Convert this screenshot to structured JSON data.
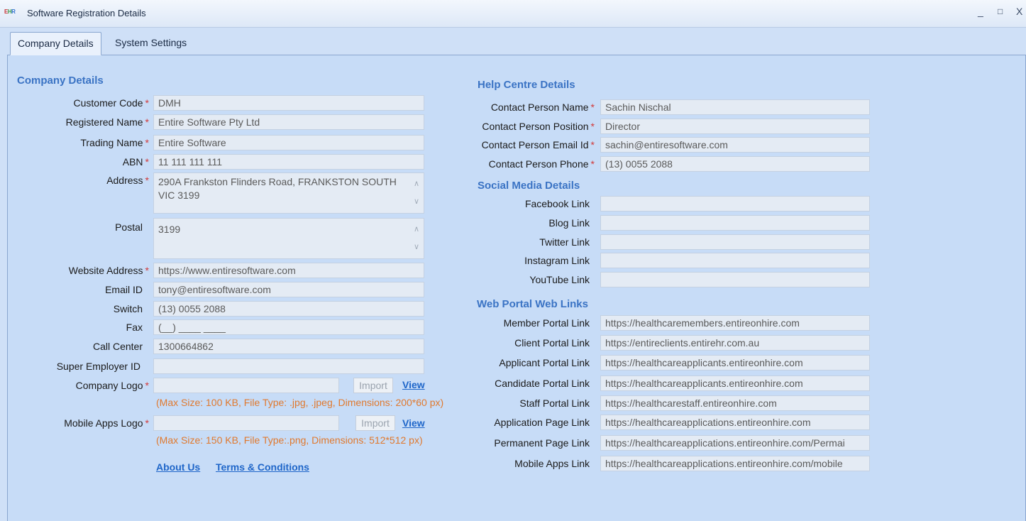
{
  "window": {
    "title": "Software Registration Details",
    "icon_letters": [
      "E",
      "H",
      "R"
    ],
    "minimize": "_",
    "maximize": "□",
    "close": "X"
  },
  "tabs": [
    "Company Details",
    "System Settings"
  ],
  "company": {
    "section_title": "Company Details",
    "customer_code": {
      "label": "Customer Code",
      "value": "DMH"
    },
    "registered_name": {
      "label": "Registered Name",
      "value": "Entire Software Pty Ltd"
    },
    "trading_name": {
      "label": "Trading Name",
      "value": "Entire Software"
    },
    "abn": {
      "label": "ABN",
      "value": "11 111 111 111"
    },
    "address": {
      "label": "Address",
      "value": "290A Frankston Flinders Road, FRANKSTON SOUTH VIC 3199"
    },
    "postal": {
      "label": "Postal",
      "value": "3199"
    },
    "website": {
      "label": "Website Address",
      "value": "https://www.entiresoftware.com"
    },
    "email": {
      "label": "Email ID",
      "value": "tony@entiresoftware.com"
    },
    "switch": {
      "label": "Switch",
      "value": "(13) 0055 2088"
    },
    "fax": {
      "label": "Fax",
      "value": "(__) ____ ____"
    },
    "call_center": {
      "label": "Call Center",
      "value": "1300664862"
    },
    "super_employer": {
      "label": "Super Employer ID",
      "value": ""
    },
    "company_logo": {
      "label": "Company Logo",
      "value": "",
      "import": "Import",
      "view": "View",
      "hint": "(Max Size: 100 KB, File Type: .jpg, .jpeg, Dimensions: 200*60 px)"
    },
    "mobile_logo": {
      "label": "Mobile Apps Logo",
      "value": "",
      "import": "Import",
      "view": "View",
      "hint": "(Max Size: 150 KB, File Type:.png, Dimensions: 512*512 px)"
    },
    "about_us": "About Us",
    "terms": "Terms & Conditions",
    "required_mark": "*"
  },
  "help": {
    "section_title": "Help Centre Details",
    "contact_name": {
      "label": "Contact Person Name",
      "value": "Sachin Nischal"
    },
    "contact_position": {
      "label": "Contact Person Position",
      "value": "Director"
    },
    "contact_email": {
      "label": "Contact Person Email Id",
      "value": "sachin@entiresoftware.com"
    },
    "contact_phone": {
      "label": "Contact Person Phone",
      "value": "(13) 0055 2088"
    }
  },
  "social": {
    "section_title": "Social Media Details",
    "facebook": {
      "label": "Facebook Link",
      "value": ""
    },
    "blog": {
      "label": "Blog Link",
      "value": ""
    },
    "twitter": {
      "label": "Twitter Link",
      "value": ""
    },
    "instagram": {
      "label": "Instagram Link",
      "value": ""
    },
    "youtube": {
      "label": "YouTube  Link",
      "value": ""
    }
  },
  "portal": {
    "section_title": "Web Portal Web Links",
    "member": {
      "label": "Member Portal Link",
      "value": "https://healthcaremembers.entireonhire.com"
    },
    "client": {
      "label": "Client Portal Link",
      "value": "https://entireclients.entirehr.com.au"
    },
    "applicant": {
      "label": "Applicant Portal Link",
      "value": "https://healthcareapplicants.entireonhire.com"
    },
    "candidate": {
      "label": "Candidate Portal Link",
      "value": "https://healthcareapplicants.entireonhire.com"
    },
    "staff": {
      "label": "Staff Portal Link",
      "value": "https://healthcarestaff.entireonhire.com"
    },
    "application_page": {
      "label": "Application Page Link",
      "value": "https://healthcareapplications.entireonhire.com"
    },
    "permanent_page": {
      "label": "Permanent Page Link",
      "value": "https://healthcareapplications.entireonhire.com/Permai"
    },
    "mobile_apps": {
      "label": "Mobile Apps Link",
      "value": "https://healthcareapplications.entireonhire.com/mobile"
    }
  }
}
